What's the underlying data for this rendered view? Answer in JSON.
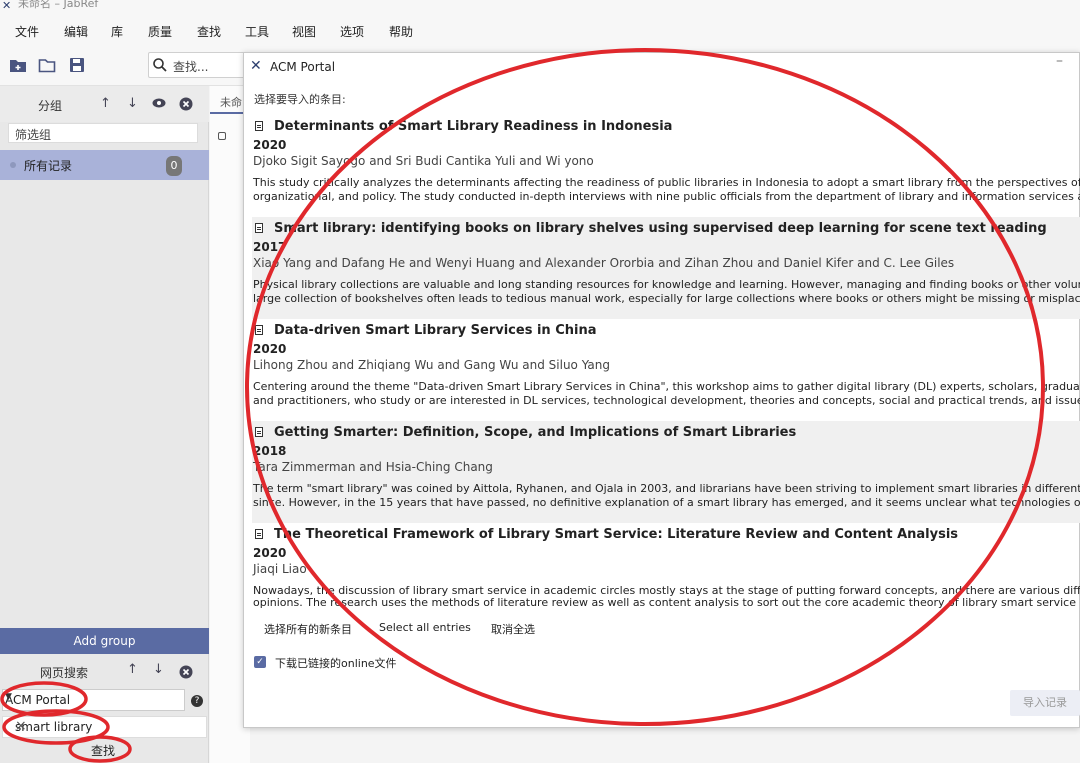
{
  "window": {
    "title": "未命名 – JabRef"
  },
  "menu": [
    "文件",
    "编辑",
    "库",
    "质量",
    "查找",
    "工具",
    "视图",
    "选项",
    "帮助"
  ],
  "toolbar": {
    "search_placeholder": "查找..."
  },
  "sidebar": {
    "groups_label": "分组",
    "filter_placeholder": "筛选组",
    "all_records": "所有记录",
    "all_records_count": "0",
    "add_group": "Add group",
    "web_search_label": "网页搜索",
    "fetcher": "ACM Portal",
    "query": "smart library",
    "search_button": "查找"
  },
  "tab": {
    "label": "未命"
  },
  "dialog": {
    "title": "ACM Portal",
    "prompt": "选择要导入的条目:",
    "entries": [
      {
        "title": "Determinants of Smart Library Readiness in Indonesia",
        "year": "2020",
        "authors": "Djoko Sigit Sayogo and Sri Budi Cantika Yuli and Wi yono",
        "abstract_line1": "This study critically analyzes the determinants affecting the readiness of public libraries in Indonesia to adopt a smart library from the perspectives of techn",
        "abstract_line2": "organizational, and policy. The study conducted in-depth interviews with nine public officials from the department of library and information services and"
      },
      {
        "title": "Smart library: identifying books on library shelves using supervised deep learning for scene text reading",
        "year": "2017",
        "authors": "Xiao Yang and Dafang He and Wenyi Huang and Alexander Ororbia and Zihan Zhou and Daniel Kifer and C. Lee Giles",
        "abstract_line1": "Physical library collections are valuable and long standing resources for knowledge and learning. However, managing and finding books or other volumes",
        "abstract_line2": "large collection of bookshelves often leads to tedious manual work, especially for large collections where books or others might be missing or misplaced."
      },
      {
        "title": "Data-driven Smart Library Services in China",
        "year": "2020",
        "authors": "Lihong Zhou and Zhiqiang Wu and Gang Wu and Siluo Yang",
        "abstract_line1": "Centering around the theme \"Data-driven Smart Library Services in China\", this workshop aims to gather digital library (DL) experts, scholars, graduate stud",
        "abstract_line2": "and practitioners, who study or are interested in DL services, technological development, theories and concepts, social and practical trends, and issues an"
      },
      {
        "title": "Getting Smarter: Definition, Scope, and Implications of Smart Libraries",
        "year": "2018",
        "authors": "Tara Zimmerman and Hsia-Ching Chang",
        "abstract_line1": "The term \"smart library\" was coined by Aittola, Ryhanen, and Ojala in 2003, and librarians have been striving to implement smart libraries in different ways",
        "abstract_line2": "since. However, in the 15 years that have passed, no definitive explanation of a smart library has emerged, and it seems unclear what technologies or serv"
      },
      {
        "title": "The Theoretical Framework of Library Smart Service: Literature Review and Content Analysis",
        "year": "2020",
        "authors": "Jiaqi Liao",
        "abstract_line1": "Nowadays, the discussion of library smart service in academic circles mostly stays at the stage of putting forward concepts, and there are various different",
        "abstract_line2": "opinions. The research uses the methods of literature review as well as content analysis to sort out the core academic theory of library smart service in 66"
      }
    ],
    "select_new": "选择所有的新条目",
    "select_all": "Select all entries",
    "deselect_all": "取消全选",
    "download_label": "下载已链接的online文件",
    "import_button": "导入记录"
  },
  "annotation_color": "#e0282c"
}
